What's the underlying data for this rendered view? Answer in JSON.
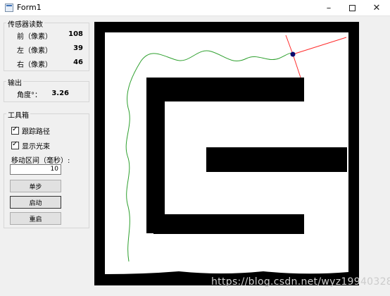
{
  "window": {
    "title": "Form1",
    "min_glyph": "–",
    "close_glyph": "✕"
  },
  "sensor": {
    "title": "传感器读数",
    "rows": [
      {
        "label": "前（像素）",
        "value": "108"
      },
      {
        "label": "左（像素）",
        "value": "39"
      },
      {
        "label": "右（像素）",
        "value": "46"
      }
    ]
  },
  "output": {
    "title": "输出",
    "label": "角度°：",
    "value": "3.26"
  },
  "toolbox": {
    "title": "工具箱",
    "track_path_label": "跟踪路径",
    "track_path_checked": true,
    "show_beam_label": "显示光束",
    "show_beam_checked": true,
    "interval_label": "移动区间（毫秒）:",
    "interval_value": "10",
    "step_label": "单步",
    "start_label": "启动",
    "reset_label": "重启"
  },
  "map": {
    "path_color": "#2ea02e",
    "beam_color": "#ff2a2a",
    "robot_color": "#0a0a6e",
    "wall_color": "#000000"
  },
  "watermark": "https://blog.csdn.net/wyz19940328"
}
